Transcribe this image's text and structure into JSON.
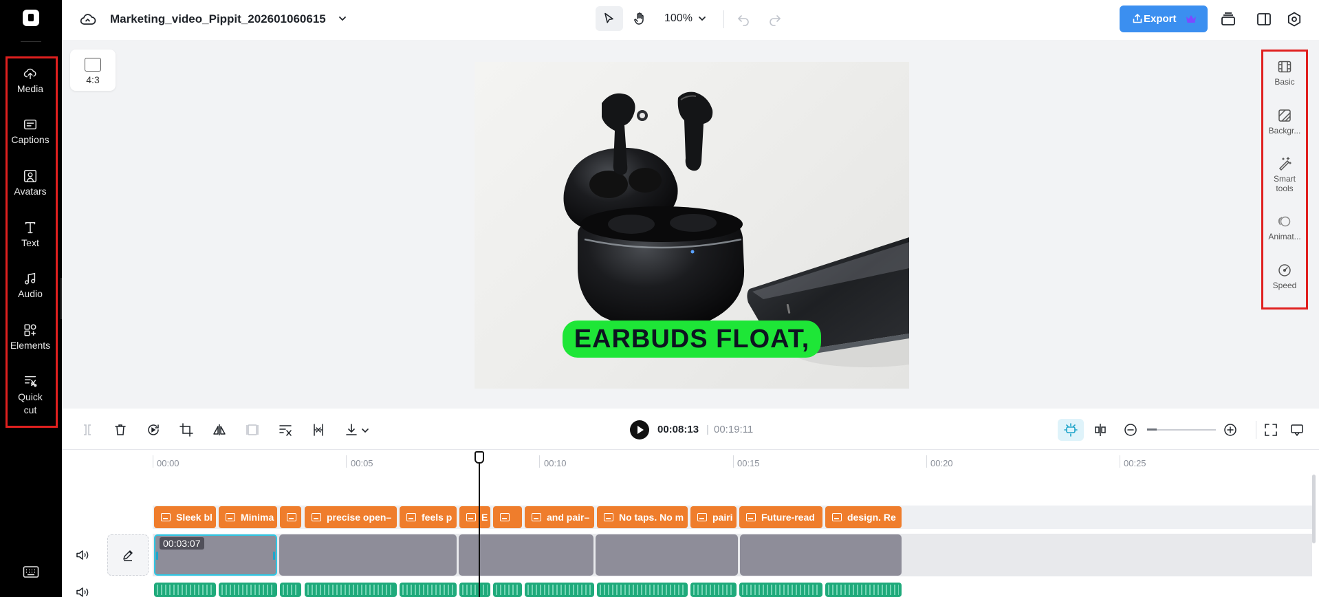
{
  "sidebar": {
    "items": [
      {
        "label": "Media",
        "icon": "cloud-upload-icon"
      },
      {
        "label": "Captions",
        "icon": "captions-icon"
      },
      {
        "label": "Avatars",
        "icon": "avatar-icon"
      },
      {
        "label": "Text",
        "icon": "text-icon"
      },
      {
        "label": "Audio",
        "icon": "music-note-icon"
      },
      {
        "label": "Elements",
        "icon": "elements-icon"
      },
      {
        "label": "Quick",
        "label2": "cut",
        "icon": "quick-cut-icon"
      }
    ],
    "highlight_color": "#e0201f"
  },
  "header": {
    "project_title": "Marketing_video_Pippit_202601060615",
    "zoom_label": "100%",
    "export_label": "Export",
    "accent_color": "#3b8ff0"
  },
  "canvas": {
    "ratio_label": "4:3",
    "caption_text": "EARBUDS FLOAT,",
    "caption_color": "#1ee637"
  },
  "right_panel": {
    "items": [
      {
        "label": "Basic",
        "icon": "film-icon"
      },
      {
        "label": "Backgr...",
        "icon": "background-icon"
      },
      {
        "label": "Smart",
        "label2": "tools",
        "icon": "magic-wand-icon"
      },
      {
        "label": "Animat...",
        "icon": "animation-icon"
      },
      {
        "label": "Speed",
        "icon": "speed-gauge-icon"
      }
    ]
  },
  "player": {
    "current_time": "00:08:13",
    "separator": "|",
    "total_time": "00:19:11"
  },
  "timeline": {
    "ticks": [
      "00:00",
      "00:05",
      "00:10",
      "00:15",
      "00:20",
      "00:25"
    ],
    "captions": [
      "Sleek bl",
      "Minima",
      "",
      "precise open–",
      "feels p",
      "E",
      "",
      "and pair–",
      "No taps. No m",
      "pairi",
      "Future-read",
      "design. Re"
    ],
    "selected_clip_duration": "00:03:07",
    "caption_color": "#ef7d2c",
    "video_color": "#8e8d99",
    "audio_color": "#1faa7b"
  }
}
